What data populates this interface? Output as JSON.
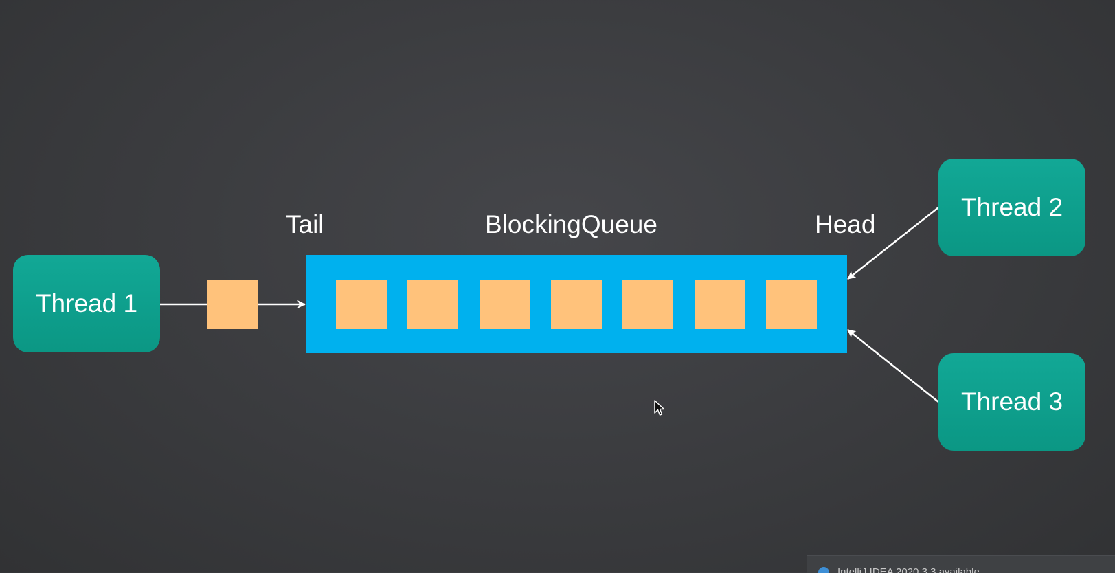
{
  "threads": {
    "thread1": "Thread 1",
    "thread2": "Thread 2",
    "thread3": "Thread 3"
  },
  "labels": {
    "tail": "Tail",
    "queue": "BlockingQueue",
    "head": "Head"
  },
  "queue": {
    "item_count": 7,
    "item_label": ""
  },
  "notification": {
    "text": "IntelliJ IDEA 2020.3.3 available"
  },
  "colors": {
    "thread_box": "#0fa390",
    "queue_bar": "#00b1ee",
    "item": "#ffc27b",
    "arrow": "#ffffff",
    "background": "#3a3b3e"
  },
  "icons": {
    "cursor": "mouse-pointer-icon",
    "notification": "info-icon"
  }
}
